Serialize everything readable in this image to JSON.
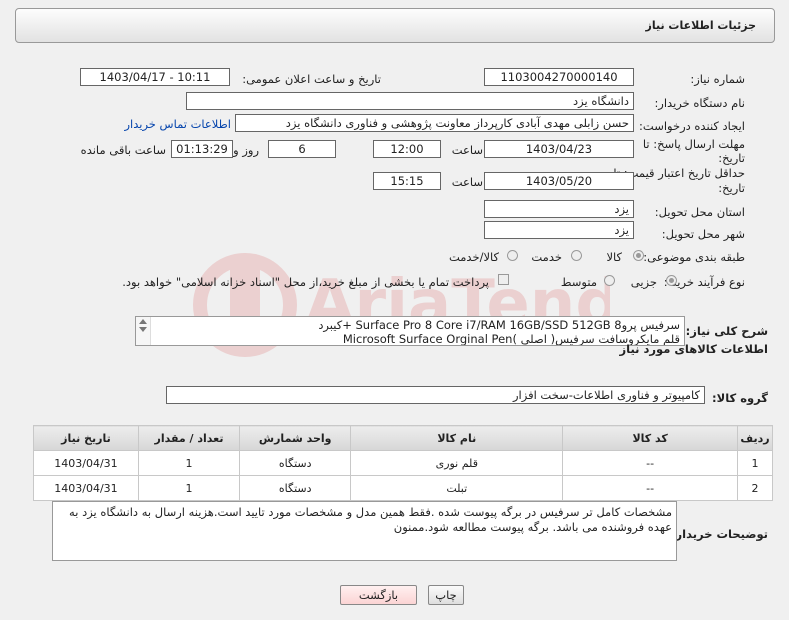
{
  "header": {
    "title": "جزئیات اطلاعات نیاز"
  },
  "form": {
    "need_number_label": "شماره نیاز:",
    "need_number": "1103004270000140",
    "announce_label": "تاریخ و ساعت اعلان عمومی:",
    "announce_value": "1403/04/17 - 10:11",
    "buyer_org_label": "نام دستگاه خریدار:",
    "buyer_org": "دانشگاه یزد",
    "creator_label": "ایجاد کننده درخواست:",
    "creator": "حسن زابلی مهدی آبادی کارپرداز معاونت پژوهشی و فناوری دانشگاه یزد",
    "contact_link": "اطلاعات تماس خریدار",
    "deadline_label_1": "مهلت ارسال پاسخ: تا",
    "deadline_label_2": "تاریخ:",
    "deadline_date": "1403/04/23",
    "time_label": "ساعت",
    "deadline_time": "12:00",
    "days_value": "6",
    "days_label": "روز و",
    "remaining_value": "01:13:29",
    "remaining_label": "ساعت باقی مانده",
    "validity_label_1": "حداقل تاریخ اعتبار قیمت: تا",
    "validity_label_2": "تاریخ:",
    "validity_date": "1403/05/20",
    "validity_time": "15:15",
    "province_label": "استان محل تحویل:",
    "province": "یزد",
    "city_label": "شهر محل تحویل:",
    "city": "یزد",
    "category_label": "طبقه بندی موضوعی:",
    "category_options": [
      "کالا",
      "خدمت",
      "کالا/خدمت"
    ],
    "process_label": "نوع فرآیند خرید :",
    "process_options": [
      "جزیی",
      "متوسط"
    ],
    "process_note": "پرداخت تمام یا بخشی از مبلغ خرید،از محل \"اسناد خزانه اسلامی\" خواهد بود."
  },
  "description": {
    "label": "شرح کلی نیاز:",
    "line1": "سرفیس پرو8  Surface Pro 8 Core i7/RAM 16GB/SSD 512GB +کیبرد",
    "line2": "قلم مایکروسافت سرفیس( اصلی )Microsoft Surface Orginal Pen"
  },
  "goods_section": {
    "title": "اطلاعات کالاهای مورد نیاز",
    "group_label": "گروه کالا:",
    "group_value": "کامپیوتر و فناوری اطلاعات-سخت افزار"
  },
  "table": {
    "headers": [
      "ردیف",
      "کد کالا",
      "نام کالا",
      "واحد شمارش",
      "تعداد / مقدار",
      "تاریخ نیاز"
    ],
    "rows": [
      [
        "1",
        "--",
        "قلم نوری",
        "دستگاه",
        "1",
        "1403/04/31"
      ],
      [
        "2",
        "--",
        "تبلت",
        "دستگاه",
        "1",
        "1403/04/31"
      ]
    ]
  },
  "buyer_notes": {
    "label": "توضیحات خریدار:",
    "text": "مشخصات کامل تر سرفیس در برگه پیوست شده .فقط همین مدل و مشخصات مورد تایید است.هزینه ارسال به دانشگاه یزد به عهده فروشنده می باشد. برگه پیوست مطالعه شود.ممنون"
  },
  "buttons": {
    "print": "چاپ",
    "back": "بازگشت"
  },
  "colors": {
    "link": "#0645ad",
    "back_button_bg": "#fde0e0"
  }
}
